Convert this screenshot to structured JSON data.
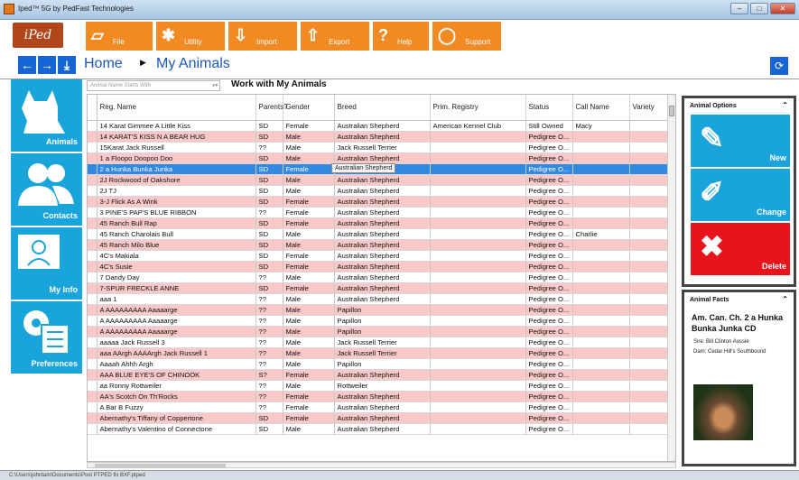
{
  "window": {
    "title": "Iped™ 5G by PedFast Technologies",
    "controls": [
      "‒",
      "□",
      "✕"
    ]
  },
  "logo": "iPed",
  "toolbar": [
    {
      "label": "File",
      "icon": "file-icon"
    },
    {
      "label": "Utility",
      "icon": "gear-icon"
    },
    {
      "label": "Import",
      "icon": "import-icon"
    },
    {
      "label": "Export",
      "icon": "export-icon"
    },
    {
      "label": "Help",
      "icon": "question-icon"
    },
    {
      "label": "Support",
      "icon": "lifebuoy-icon"
    }
  ],
  "breadcrumb": {
    "home": "Home",
    "current": "My Animals"
  },
  "sidebar": [
    {
      "label": "Animals",
      "icon": "dog-icon"
    },
    {
      "label": "Contacts",
      "icon": "people-icon"
    },
    {
      "label": "My Info",
      "icon": "person-icon"
    },
    {
      "label": "Preferences",
      "icon": "gear-list-icon"
    }
  ],
  "search": {
    "placeholder": "Animal Name Starts With"
  },
  "work_title": "Work with My Animals",
  "grid": {
    "columns": [
      "Reg. Name",
      "Parents?",
      "Gender",
      "Breed",
      "Prim. Registry",
      "Status",
      "Call Name",
      "Variety"
    ],
    "rows": [
      [
        "14 Karat Gimmee A Little Kiss",
        "SD",
        "Female",
        "Australian Shepherd",
        "American Kennel Club",
        "Still Owned",
        "Macy",
        ""
      ],
      [
        "14 KARAT'S KISS N A BEAR HUG",
        "SD",
        "Male",
        "Australian Shepherd",
        "",
        "Pedigree O...",
        "",
        ""
      ],
      [
        "15Karat Jack Russell",
        "??",
        "Male",
        "Jack Russell Terrier",
        "",
        "Pedigree O...",
        "",
        ""
      ],
      [
        "1 a Floopo Doopoo Doo",
        "SD",
        "Male",
        "Australian Shepherd",
        "",
        "Pedigree O...",
        "",
        ""
      ],
      [
        "2 a Hunka Bunka Junka",
        "SD",
        "Female",
        "Au",
        "",
        "Pedigree O...",
        "",
        ""
      ],
      [
        "2J Rockwood of Oakshore",
        "SD",
        "Male",
        "Australian Shepherd",
        "",
        "Pedigree O...",
        "",
        ""
      ],
      [
        "2J TJ",
        "SD",
        "Male",
        "Australian Shepherd",
        "",
        "Pedigree O...",
        "",
        ""
      ],
      [
        "3-J Flick As A Wink",
        "SD",
        "Female",
        "Australian Shepherd",
        "",
        "Pedigree O...",
        "",
        ""
      ],
      [
        "3 PINE'S PAP'S BLUE RIBBON",
        "??",
        "Female",
        "Australian Shepherd",
        "",
        "Pedigree O...",
        "",
        ""
      ],
      [
        "45 Ranch Bull Rap",
        "SD",
        "Female",
        "Australian Shepherd",
        "",
        "Pedigree O...",
        "",
        ""
      ],
      [
        "45 Ranch Charolais Bull",
        "SD",
        "Male",
        "Australian Shepherd",
        "",
        "Pedigree O...",
        "Charlie",
        ""
      ],
      [
        "45 Ranch Milo Blue",
        "SD",
        "Male",
        "Australian Shepherd",
        "",
        "Pedigree O...",
        "",
        ""
      ],
      [
        "4C's Makiala",
        "SD",
        "Female",
        "Australian Shepherd",
        "",
        "Pedigree O...",
        "",
        ""
      ],
      [
        "4C's Susie",
        "SD",
        "Female",
        "Australian Shepherd",
        "",
        "Pedigree O...",
        "",
        ""
      ],
      [
        "7 Dandy Day",
        "??",
        "Male",
        "Australian Shepherd",
        "",
        "Pedigree O...",
        "",
        ""
      ],
      [
        "7-SPUR FRECKLE ANNE",
        "SD",
        "Female",
        "Australian Shepherd",
        "",
        "Pedigree O...",
        "",
        ""
      ],
      [
        "aaa 1",
        "??",
        "Male",
        "Australian Shepherd",
        "",
        "Pedigree O...",
        "",
        ""
      ],
      [
        "A AAAAAAAAA Aaaaarge",
        "??",
        "Male",
        "Papillon",
        "",
        "Pedigree O...",
        "",
        ""
      ],
      [
        "A AAAAAAAAA Aaaaarge",
        "??",
        "Male",
        "Papillon",
        "",
        "Pedigree O...",
        "",
        ""
      ],
      [
        "A AAAAAAAAA Aaaaarge",
        "??",
        "Male",
        "Papillon",
        "",
        "Pedigree O...",
        "",
        ""
      ],
      [
        "aaaaa Jack Russell 3",
        "??",
        "Male",
        "Jack Russell Terrier",
        "",
        "Pedigree O...",
        "",
        ""
      ],
      [
        "aaa AArgh AAAArgh Jack Russell 1",
        "??",
        "Male",
        "Jack Russell Terrier",
        "",
        "Pedigree O...",
        "",
        ""
      ],
      [
        "Aaaah Ahhh Argh",
        "??",
        "Male",
        "Papillon",
        "",
        "Pedigree O...",
        "",
        ""
      ],
      [
        "AAA BLUE EYE'S OF CHINOOK",
        "S?",
        "Female",
        "Australian Shepherd",
        "",
        "Pedigree O...",
        "",
        ""
      ],
      [
        "aa Ronny Rottweiler",
        "??",
        "Male",
        "Rottweiler",
        "",
        "Pedigree O...",
        "",
        ""
      ],
      [
        "AA's Scotch On Th'Rocks",
        "??",
        "Female",
        "Australian Shepherd",
        "",
        "Pedigree O...",
        "",
        ""
      ],
      [
        "A Bar B Fuzzy",
        "??",
        "Female",
        "Australian Shepherd",
        "",
        "Pedigree O...",
        "",
        ""
      ],
      [
        "Abernathy's Tiffany of Coppertone",
        "SD",
        "Female",
        "Australian Shepherd",
        "",
        "Pedigree O...",
        "",
        ""
      ],
      [
        "Abernathy's Valentino of Connectone",
        "SD",
        "Male",
        "Australian Shepherd",
        "",
        "Pedigree O...",
        "",
        ""
      ]
    ],
    "selected_row": 4,
    "tooltip": "Australian Shepherd",
    "row_colors": {
      "pink": "#fbc8c8",
      "selected": "#3388e0"
    }
  },
  "animal_options": {
    "title": "Animal Options",
    "buttons": [
      {
        "label": "New",
        "color": "#1aa4dc",
        "icon": "new-doc-icon"
      },
      {
        "label": "Change",
        "color": "#1aa4dc",
        "icon": "pencil-icon"
      },
      {
        "label": "Delete",
        "color": "#e8131b",
        "icon": "x-icon"
      }
    ]
  },
  "animal_facts": {
    "title": "Animal Facts",
    "name": "Am. Can. Ch. 2 a Hunka Bunka Junka CD",
    "sire": "Sire: Bill Clinton Aussie",
    "dam": "Dam: Cedar Hill's Southbound"
  },
  "statusbar": "C:\\Users\\johntam\\Documents\\Post PTPED fix BXF.ptped",
  "colors": {
    "accent": "#f28a24",
    "nav_blue": "#1665d6",
    "tile_blue": "#1aa4dc"
  }
}
